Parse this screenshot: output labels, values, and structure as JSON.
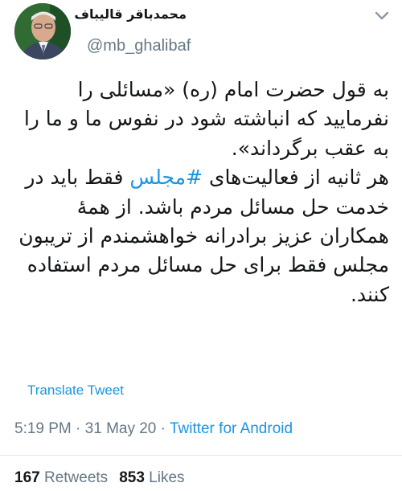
{
  "author": {
    "display_name": "محمدباقر قالیباف",
    "handle": "@mb_ghalibaf"
  },
  "tweet": {
    "paragraph_1": "به قول حضرت امام (ره) «مسائلی را نفرمایید که انباشته شود در نفوس ما و ما را به عقب برگرداند».",
    "paragraph_2_before": "هر ثانیه از فعالیت‌های ",
    "hashtag": "#مجلس",
    "paragraph_2_after": " فقط باید در خدمت حل مسائل مردم باشد. از همهٔ همکاران عزیز برادرانه خواهشمندم از تریبون مجلس فقط برای حل مسائل مردم استفاده کنند.",
    "translate_label": "Translate Tweet"
  },
  "meta": {
    "time": "5:19 PM",
    "separator": "·",
    "date": "31 May 20",
    "source": "Twitter for Android"
  },
  "stats": {
    "retweets_count": "167",
    "retweets_label": "Retweets",
    "likes_count": "853",
    "likes_label": "Likes"
  },
  "colors": {
    "link": "#1b95e0",
    "secondary_text": "#657786",
    "primary_text": "#14171a"
  }
}
